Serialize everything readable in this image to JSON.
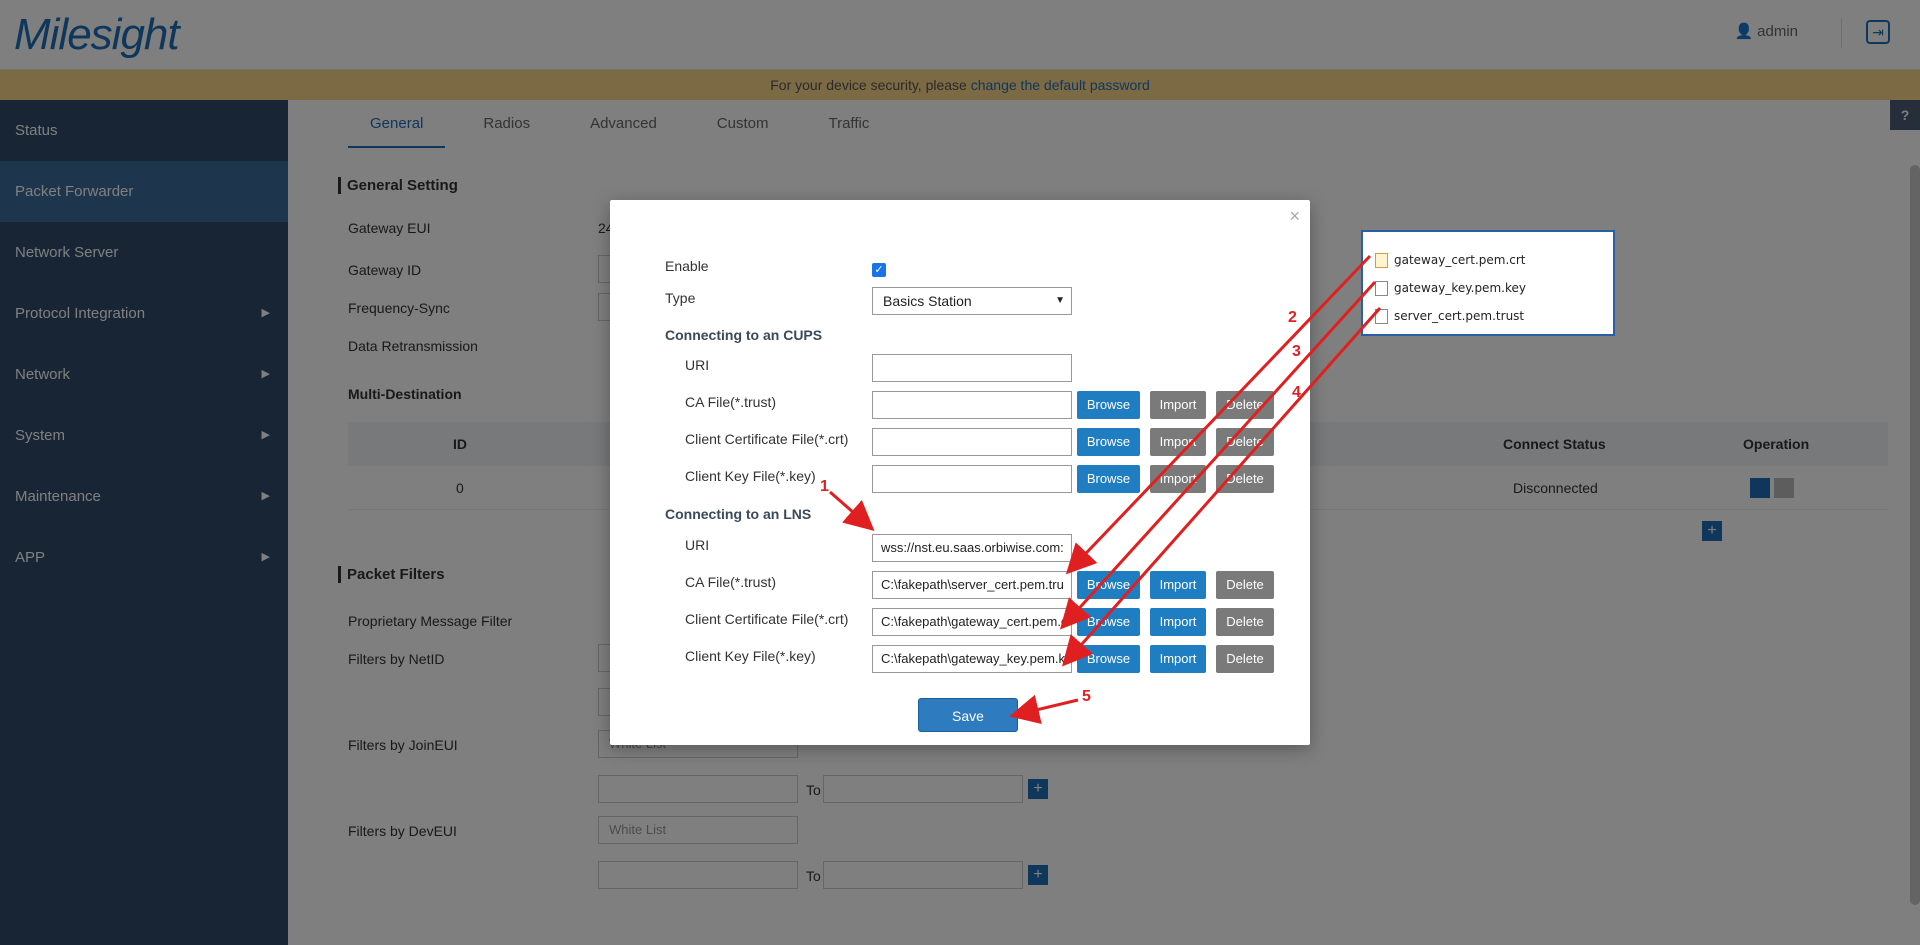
{
  "header": {
    "logo": "Milesight",
    "user_label": "admin"
  },
  "notice": {
    "text": "For your device security, please ",
    "link": "change the default password"
  },
  "sidebar": {
    "items": [
      {
        "label": "Status",
        "arrow": ""
      },
      {
        "label": "Packet Forwarder",
        "arrow": ""
      },
      {
        "label": "Network Server",
        "arrow": ""
      },
      {
        "label": "Protocol Integration",
        "arrow": "▶"
      },
      {
        "label": "Network",
        "arrow": "▶"
      },
      {
        "label": "System",
        "arrow": "▶"
      },
      {
        "label": "Maintenance",
        "arrow": "▶"
      },
      {
        "label": "APP",
        "arrow": "▶"
      }
    ]
  },
  "tabs": [
    "General",
    "Radios",
    "Advanced",
    "Custom",
    "Traffic"
  ],
  "general": {
    "section_title": "General Setting",
    "gateway_eui": "Gateway EUI",
    "gateway_eui_value": "24",
    "gateway_id": "Gateway ID",
    "frequency_sync": "Frequency-Sync",
    "data_retransmission": "Data Retransmission",
    "multi_destination": "Multi-Destination",
    "table": {
      "id_header": "ID",
      "connect_status_header": "Connect Status",
      "operation_header": "Operation",
      "row_id": "0",
      "row_status": "Disconnected"
    },
    "packet_filters": "Packet Filters",
    "proprietary": "Proprietary Message Filter",
    "filters_netid": "Filters by NetID",
    "filters_joineui": "Filters by JoinEUI",
    "filters_deveui": "Filters by DevEUI",
    "white_list_1": "White List",
    "white_list_2": "White List",
    "to_1": "To",
    "to_2": "To"
  },
  "help": "?",
  "modal": {
    "close": "×",
    "enable_label": "Enable",
    "type_label": "Type",
    "type_value": "Basics Station",
    "cups_heading": "Connecting to an CUPS",
    "lns_heading": "Connecting to an LNS",
    "uri_label": "URI",
    "ca_label": "CA File(*.trust)",
    "cert_label": "Client Certificate File(*.crt)",
    "key_label": "Client Key File(*.key)",
    "lns_uri_value": "wss://nst.eu.saas.orbiwise.com:",
    "lns_ca_value": "C:\\fakepath\\server_cert.pem.tru",
    "lns_cert_value": "C:\\fakepath\\gateway_cert.pem.c",
    "lns_key_value": "C:\\fakepath\\gateway_key.pem.k",
    "browse": "Browse",
    "import": "Import",
    "delete": "Delete",
    "save": "Save"
  },
  "files": [
    {
      "name": "gateway_cert.pem.crt",
      "icon": "certificate-file-icon"
    },
    {
      "name": "gateway_key.pem.key",
      "icon": "file-icon"
    },
    {
      "name": "server_cert.pem.trust",
      "icon": "file-icon"
    }
  ],
  "annotations": [
    "1",
    "2",
    "3",
    "4",
    "5"
  ],
  "colors": {
    "brand": "#1f6fb8",
    "sidebar": "#2f4a6b",
    "button_blue": "#1f7ec2",
    "button_gray": "#7a7a7a",
    "annotation": "#e02020"
  }
}
